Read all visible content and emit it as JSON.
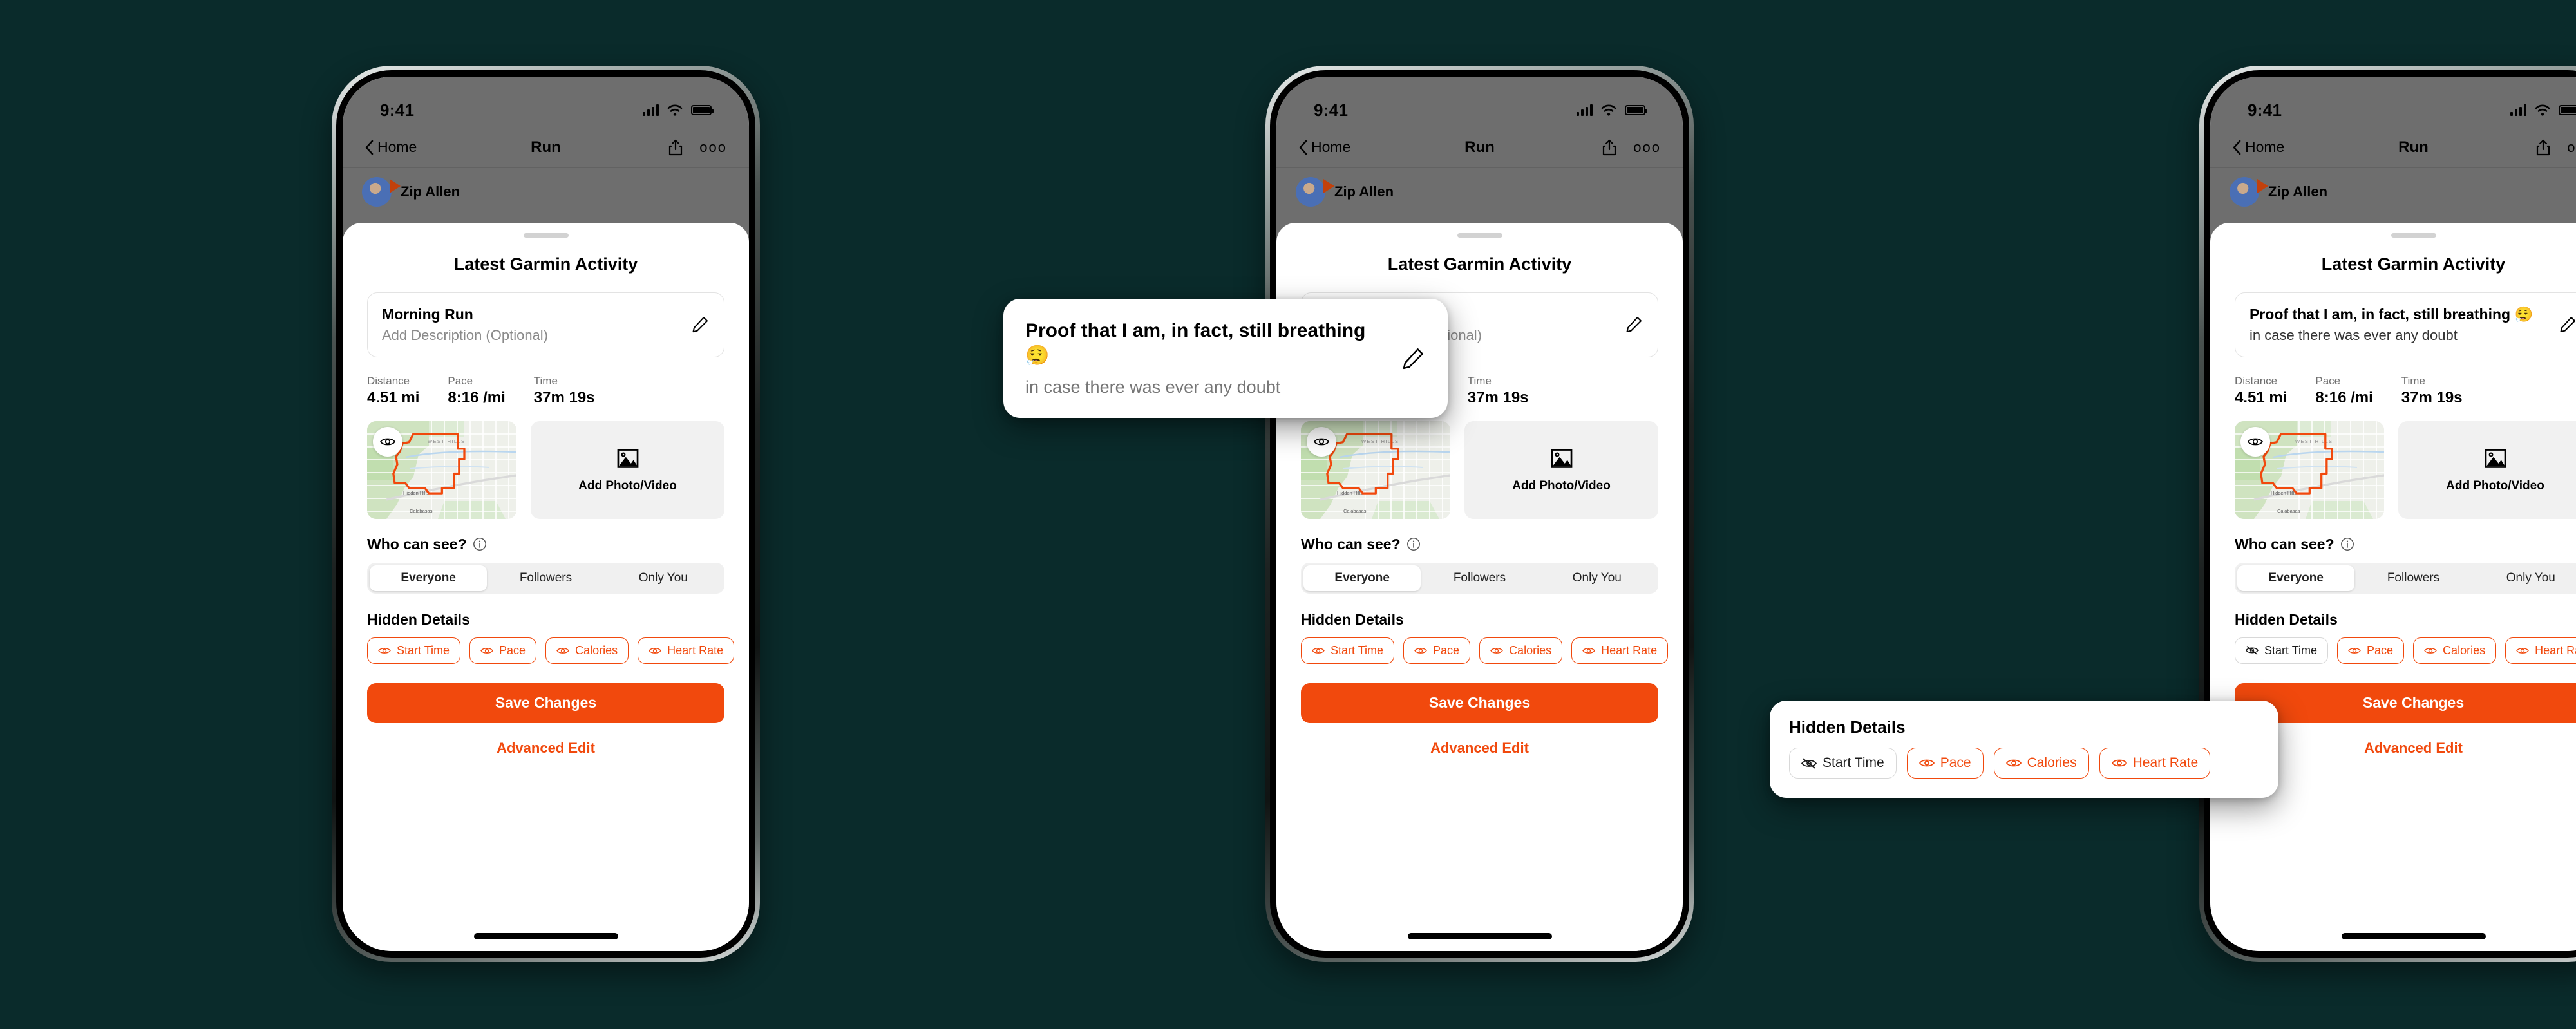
{
  "background_color": "#0a2b2b",
  "accent_color": "#f1490d",
  "status_bar": {
    "time": "9:41",
    "signal_icon": "cellular-bars-icon",
    "wifi_icon": "wifi-icon",
    "battery_icon": "battery-icon"
  },
  "nav": {
    "back_label": "Home",
    "title": "Run",
    "share_icon": "share-icon",
    "more_icon": "more-options-icon"
  },
  "feed": {
    "user_name": "Zip Allen"
  },
  "sheet": {
    "title": "Latest Garmin Activity",
    "description": {
      "empty_title": "Morning Run",
      "empty_placeholder": "Add Description (Optional)",
      "filled_title": "Proof that I am, in fact, still breathing 😮‍💨",
      "filled_sub": "in case there was ever any doubt",
      "edit_icon": "pencil-icon"
    },
    "stats": [
      {
        "label": "Distance",
        "value": "4.51 mi"
      },
      {
        "label": "Pace",
        "value": "8:16 /mi"
      },
      {
        "label": "Time",
        "value": "37m 19s"
      }
    ],
    "map": {
      "visibility_icon": "eye-icon",
      "labels": [
        "WEST HILLS",
        "Hidden Hills",
        "Calabasas"
      ],
      "route_color": "#f1490d"
    },
    "photo": {
      "icon": "image-icon",
      "label": "Add Photo/Video"
    },
    "privacy": {
      "title": "Who can see?",
      "info_icon": "info-icon",
      "options": [
        "Everyone",
        "Followers",
        "Only You"
      ],
      "selected": "Everyone"
    },
    "hidden_details": {
      "title": "Hidden Details",
      "chips": [
        {
          "label": "Start Time",
          "icon": "eye-icon",
          "hidden": false
        },
        {
          "label": "Pace",
          "icon": "eye-icon",
          "hidden": false
        },
        {
          "label": "Calories",
          "icon": "eye-icon",
          "hidden": false
        },
        {
          "label": "Heart Rate",
          "icon": "eye-icon",
          "hidden": false
        }
      ],
      "chips_toggled": [
        {
          "label": "Start Time",
          "icon": "eye-off-icon",
          "hidden": true
        },
        {
          "label": "Pace",
          "icon": "eye-icon",
          "hidden": false
        },
        {
          "label": "Calories",
          "icon": "eye-icon",
          "hidden": false
        },
        {
          "label": "Heart Rate",
          "icon": "eye-icon",
          "hidden": false
        }
      ]
    },
    "save_label": "Save Changes",
    "advanced_edit_label": "Advanced Edit"
  }
}
